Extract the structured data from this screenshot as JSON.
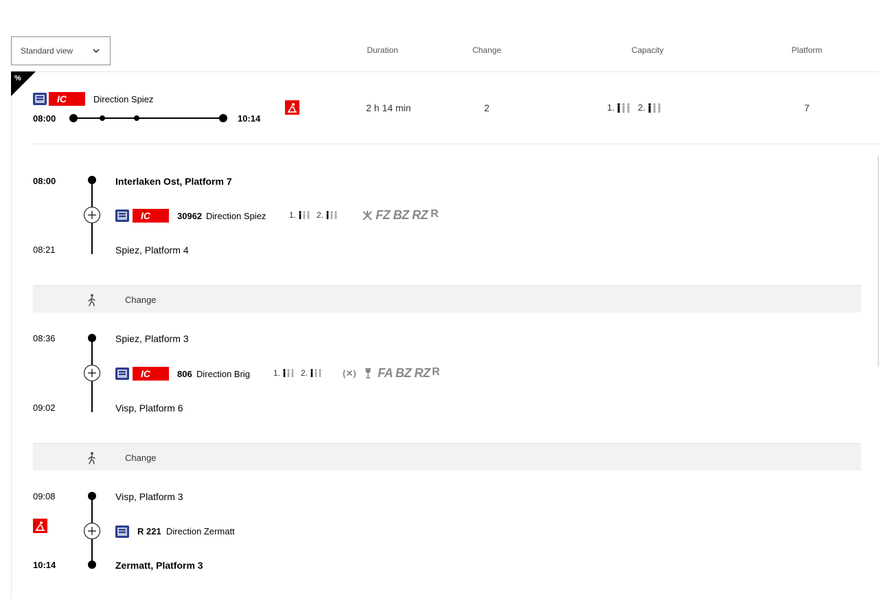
{
  "header": {
    "view_select": "Standard view",
    "columns": {
      "duration": "Duration",
      "change": "Change",
      "capacity": "Capacity",
      "platform": "Platform"
    }
  },
  "summary": {
    "direction": "Direction Spiez",
    "departure": "08:00",
    "arrival": "10:14",
    "duration": "2 h 14 min",
    "changes": "2",
    "capacity_first": "1.",
    "capacity_second": "2.",
    "platform": "7",
    "product_badge": "IC",
    "discount_symbol": "%"
  },
  "legs": [
    {
      "dep_time": "08:00",
      "dep_stop": "Interlaken Ost, Platform 7",
      "train_number": "30962",
      "direction": "Direction Spiez",
      "cap_first": "1.",
      "cap_second": "2.",
      "services": "FZ BZ RZ",
      "reservation": "R",
      "arr_time": "08:21",
      "arr_stop": "Spiez, Platform 4",
      "product_badge": "IC"
    },
    {
      "dep_time": "08:36",
      "dep_stop": "Spiez, Platform 3",
      "train_number": "806",
      "direction": "Direction Brig",
      "cap_first": "1.",
      "cap_second": "2.",
      "services": "FA BZ RZ",
      "reservation": "R",
      "restaurant_note": "(✕)",
      "arr_time": "09:02",
      "arr_stop": "Visp, Platform 6",
      "product_badge": "IC"
    },
    {
      "dep_time": "09:08",
      "dep_stop": "Visp, Platform 3",
      "train_number": "R 221",
      "direction": "Direction Zermatt",
      "arr_time": "10:14",
      "arr_stop": "Zermatt, Platform 3"
    }
  ],
  "changes": [
    {
      "label": "Change"
    },
    {
      "label": "Change"
    }
  ],
  "colors": {
    "sbb_red": "#eb0000",
    "train_blue": "#2c3e8f",
    "band_gray": "#f2f2f2"
  }
}
